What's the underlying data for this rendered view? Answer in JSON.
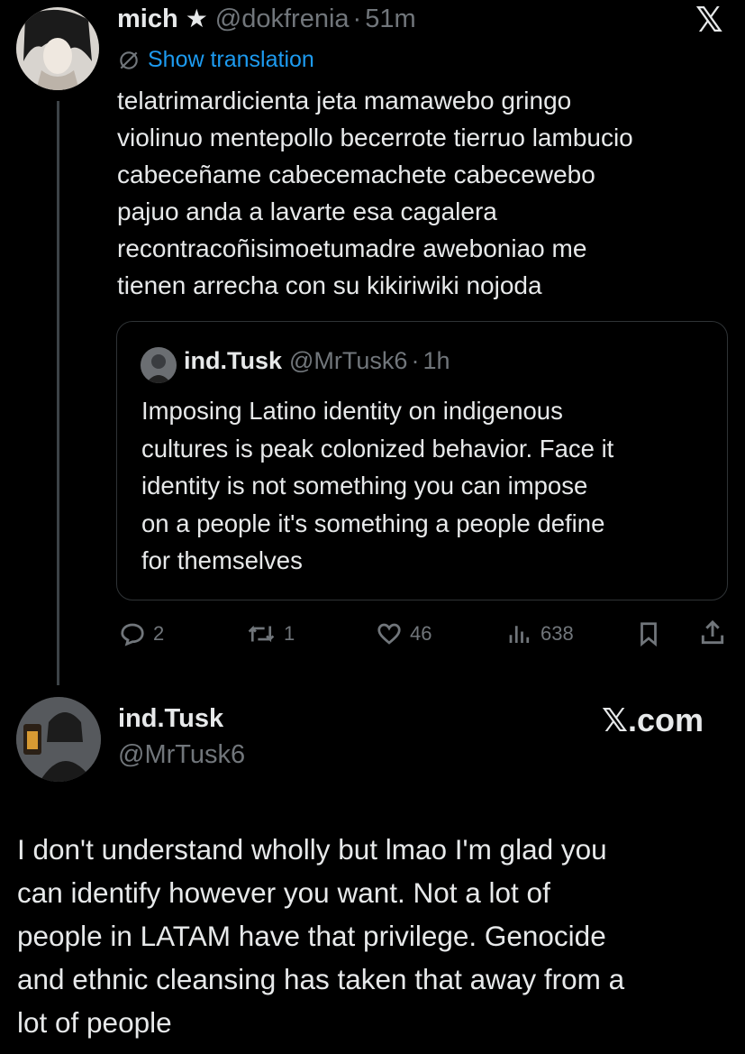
{
  "tweet": {
    "author_name": "mich",
    "author_badge": "★",
    "handle": "@dokfrenia",
    "separator": "·",
    "time": "51m",
    "translate_label": "Show translation",
    "text": "telatrimardicienta jeta mamawebo gringo\nviolinuo mentepollo becerrote tierruo lambucio\ncabeceñame cabecemachete cabecewebo\npajuo anda a lavarte esa cagalera\nrecontracoñisimoetumadre aweboniao me\ntienen arrecha con su kikiriwiki nojoda",
    "x_logo": "𝕏",
    "quote": {
      "author_name": "ind.Tusk",
      "handle": "@MrTusk6",
      "separator": "·",
      "time": "1h",
      "text": "Imposing Latino identity on indigenous\ncultures is peak colonized behavior. Face it\nidentity is not something you can impose\non a people it's something a people define\nfor themselves"
    },
    "actions": {
      "replies": "2",
      "reposts": "1",
      "likes": "46",
      "views": "638"
    }
  },
  "reply": {
    "author_name": "ind.Tusk",
    "handle": "@MrTusk6",
    "site_label": "𝕏.com",
    "text": "I don't understand wholly but lmao I'm glad you\ncan identify however you want. Not a lot of\npeople in LATAM have that privilege. Genocide\nand ethnic cleansing has taken that away from a\nlot of people"
  },
  "colors": {
    "background": "#000000",
    "text": "#e7e9ea",
    "muted": "#71767b",
    "link": "#1d9bf0",
    "border": "#2f3336"
  }
}
